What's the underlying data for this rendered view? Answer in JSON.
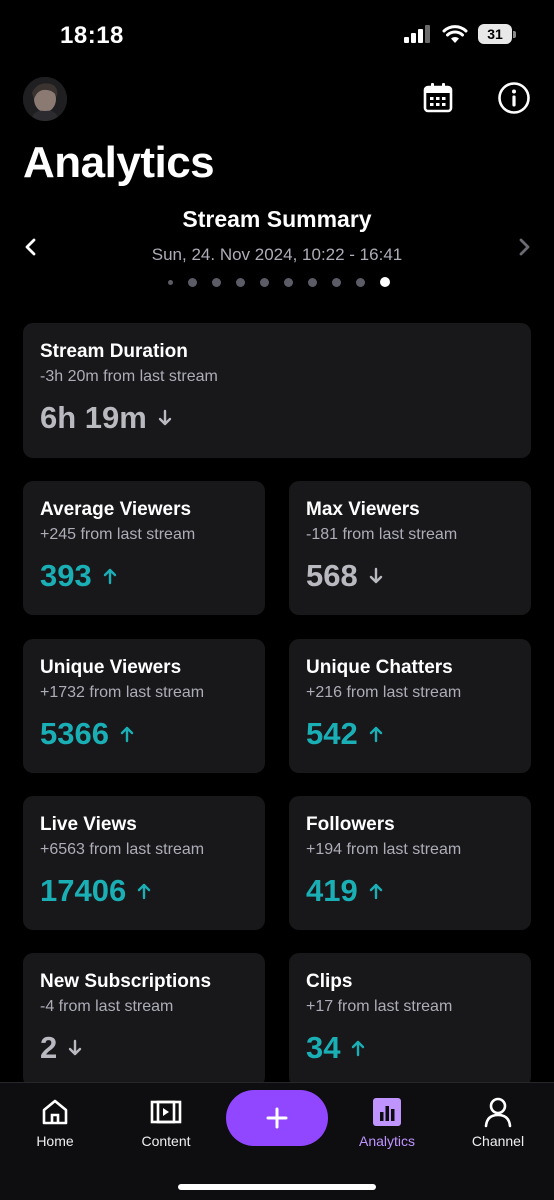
{
  "status_bar": {
    "time": "18:18",
    "battery": "31"
  },
  "header": {
    "title": "Analytics"
  },
  "summary": {
    "title": "Stream Summary",
    "date": "Sun, 24. Nov 2024, 10:22 - 16:41",
    "dot_count": 10,
    "active_dot": 9
  },
  "cards": {
    "stream_duration": {
      "title": "Stream Duration",
      "sub": "-3h 20m from last stream",
      "value": "6h 19m",
      "trend": "down"
    },
    "average_viewers": {
      "title": "Average Viewers",
      "sub": "+245 from last stream",
      "value": "393",
      "trend": "up"
    },
    "max_viewers": {
      "title": "Max Viewers",
      "sub": "-181 from last stream",
      "value": "568",
      "trend": "down"
    },
    "unique_viewers": {
      "title": "Unique Viewers",
      "sub": "+1732 from last stream",
      "value": "5366",
      "trend": "up"
    },
    "unique_chatters": {
      "title": "Unique Chatters",
      "sub": "+216 from last stream",
      "value": "542",
      "trend": "up"
    },
    "live_views": {
      "title": "Live Views",
      "sub": "+6563 from last stream",
      "value": "17406",
      "trend": "up"
    },
    "followers": {
      "title": "Followers",
      "sub": "+194 from last stream",
      "value": "419",
      "trend": "up"
    },
    "new_subscriptions": {
      "title": "New Subscriptions",
      "sub": "-4 from last stream",
      "value": "2",
      "trend": "down"
    },
    "clips": {
      "title": "Clips",
      "sub": "+17 from last stream",
      "value": "34",
      "trend": "up"
    }
  },
  "tabs": [
    {
      "label": "Home",
      "icon": "home-icon"
    },
    {
      "label": "Content",
      "icon": "content-icon"
    },
    {
      "label": "",
      "icon": "plus-icon"
    },
    {
      "label": "Analytics",
      "icon": "analytics-icon",
      "active": true
    },
    {
      "label": "Channel",
      "icon": "person-icon"
    }
  ],
  "colors": {
    "accent": "#9147ff",
    "accent_light": "#bf94ff",
    "up": "#1aaeb5",
    "down": "#b9b9c0",
    "card_bg": "#18181b"
  }
}
